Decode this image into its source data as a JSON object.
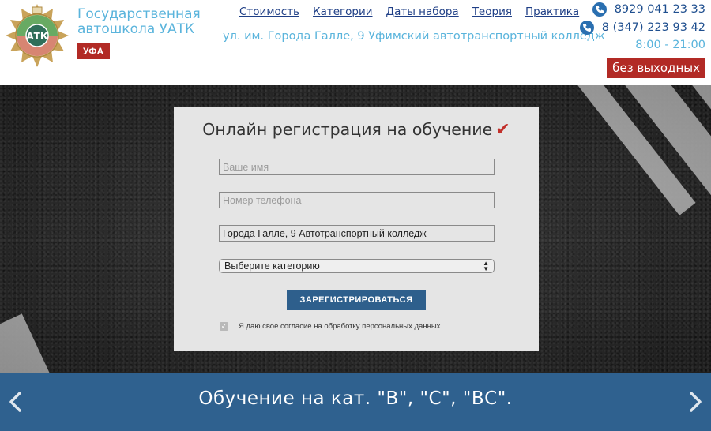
{
  "header": {
    "brand_line1": "Государственная",
    "brand_line2": "автошкола УАТК",
    "city_badge": "УФА",
    "nav": [
      {
        "label": "Стоимость"
      },
      {
        "label": "Категории"
      },
      {
        "label": "Даты набора"
      },
      {
        "label": "Теория"
      },
      {
        "label": "Практика"
      }
    ],
    "address": "ул. им. Города Галле, 9 Уфимский автотранспортный колледж",
    "phone1": "8929 041 23 33",
    "phone2": "8 (347) 223 93 42",
    "hours": "8:00 - 21:00",
    "no_days_off": "без выходных",
    "logo_text": "АТК"
  },
  "form": {
    "title": "Онлайн регистрация на обучение",
    "title_mark": "✔",
    "name_placeholder": "Ваше имя",
    "phone_placeholder": "Номер телефона",
    "address_value": "Города Галле, 9 Автотранспортный колледж",
    "category_select": "Выберите категорию",
    "submit_label": "ЗАРЕГИСТРИРОВАТЬСЯ",
    "consent_checked": true,
    "consent_text": "Я даю свое согласие на обработку персональных данных"
  },
  "banner": {
    "text": "Обучение на кат. \"В\", \"С\", \"ВС\"."
  },
  "colors": {
    "brand_blue_light": "#5ab4dc",
    "nav_blue": "#1f3f86",
    "accent_red": "#b22a25",
    "button_blue": "#2e5f8c",
    "banner_blue": "#2f618f"
  }
}
